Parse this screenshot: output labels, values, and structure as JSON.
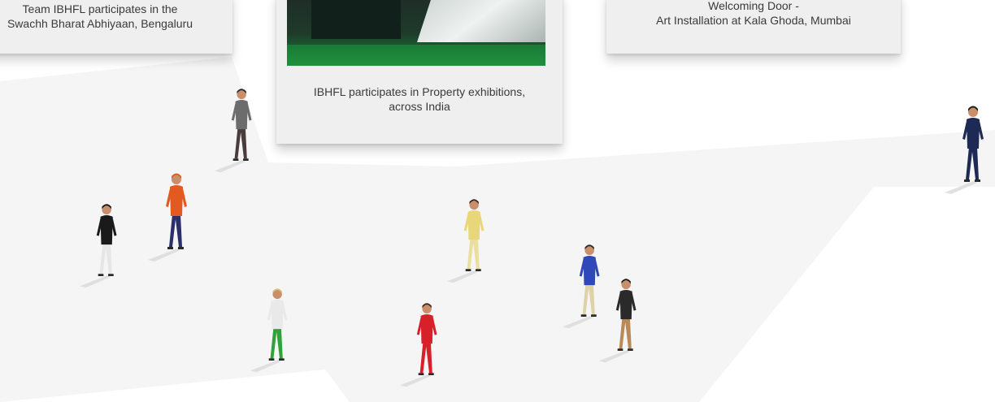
{
  "cards": [
    {
      "caption_lines": [
        "Team IBHFL participates in the",
        "Swachh Bharat Abhiyaan, Bengaluru"
      ]
    },
    {
      "caption_lines": [
        "IBHFL participates in Property exhibitions,",
        "across India"
      ]
    },
    {
      "caption_lines": [
        "Welcoming Door -",
        "Art Installation at Kala Ghoda, Mumbai"
      ]
    }
  ],
  "colors": {
    "card_bg": "#efefef",
    "text": "#3a3a3a",
    "wedge": "#f6f6f6"
  },
  "figures": [
    {
      "name": "person-grey-coat",
      "shirt": "#6c6c6c",
      "pants": "#4a3c3a",
      "hair": "#2a2a2a"
    },
    {
      "name": "person-black-outfit",
      "shirt": "#1a1a1a",
      "pants": "#e6e6e6",
      "hair": "#111111"
    },
    {
      "name": "person-orange-hair",
      "shirt": "#e25a20",
      "pants": "#2b2f6a",
      "hair": "#e65a1a"
    },
    {
      "name": "person-yellow-outfit",
      "shirt": "#e8d77a",
      "pants": "#eadf9c",
      "hair": "#3b2a1a"
    },
    {
      "name": "person-green-pants",
      "shirt": "#e9e9e9",
      "pants": "#2fa338",
      "hair": "#d8c07a"
    },
    {
      "name": "person-red-dress",
      "shirt": "#d8202a",
      "pants": "#d8202a",
      "hair": "#3a2a22"
    },
    {
      "name": "person-blue-shirt",
      "shirt": "#2f49b8",
      "pants": "#ddd3a6",
      "hair": "#2a2a2a"
    },
    {
      "name": "person-dark-top",
      "shirt": "#2a2a2a",
      "pants": "#b98a55",
      "hair": "#1a1a1a"
    },
    {
      "name": "person-cyclist",
      "shirt": "#1d2a55",
      "pants": "#1d2a55",
      "hair": "#1a1a1a"
    }
  ]
}
